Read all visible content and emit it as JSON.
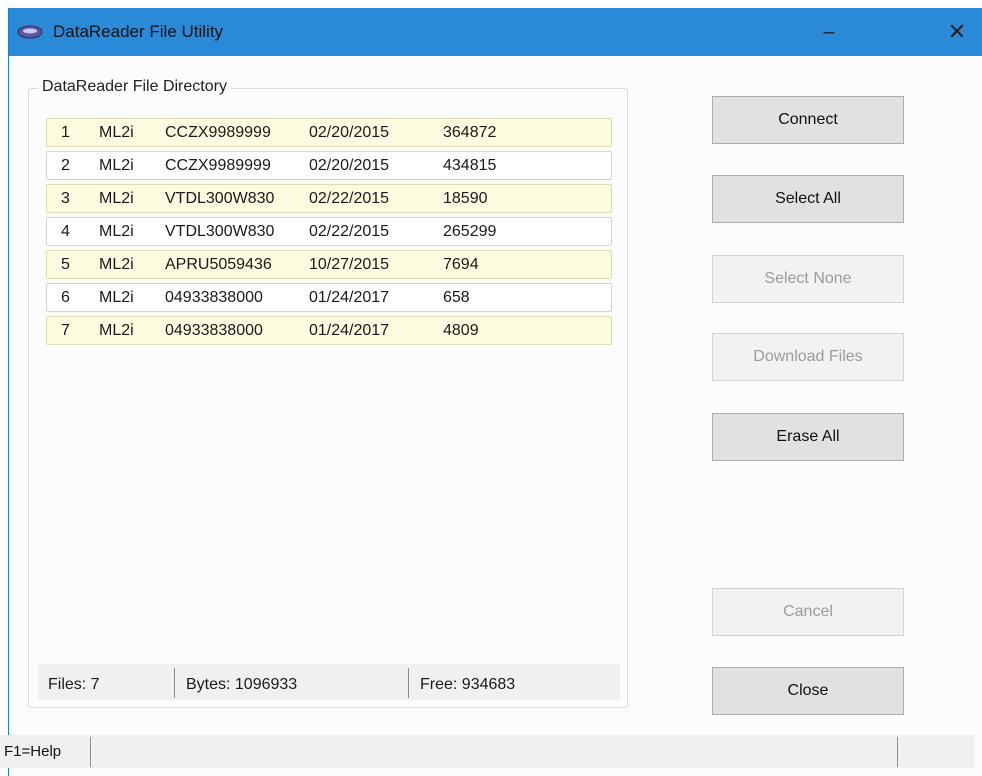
{
  "window": {
    "title": "DataReader File Utility",
    "minimize_glyph": "–",
    "close_glyph": "✕",
    "app_icon": "datareader-app-icon"
  },
  "directory": {
    "legend": "DataReader File Directory",
    "files": [
      {
        "num": "1",
        "model": "ML2i",
        "name": "CCZX9989999",
        "date": "02/20/2015",
        "size": "364872"
      },
      {
        "num": "2",
        "model": "ML2i",
        "name": "CCZX9989999",
        "date": "02/20/2015",
        "size": "434815"
      },
      {
        "num": "3",
        "model": "ML2i",
        "name": "VTDL300W830",
        "date": "02/22/2015",
        "size": "18590"
      },
      {
        "num": "4",
        "model": "ML2i",
        "name": "VTDL300W830",
        "date": "02/22/2015",
        "size": "265299"
      },
      {
        "num": "5",
        "model": "ML2i",
        "name": "APRU5059436",
        "date": "10/27/2015",
        "size": "7694"
      },
      {
        "num": "6",
        "model": "ML2i",
        "name": "04933838000",
        "date": "01/24/2017",
        "size": "658"
      },
      {
        "num": "7",
        "model": "ML2i",
        "name": "04933838000",
        "date": "01/24/2017",
        "size": "4809"
      }
    ]
  },
  "stats": {
    "files": "Files:  7",
    "bytes": "Bytes: 1096933",
    "free": "Free:  934683"
  },
  "buttons": {
    "connect": "Connect",
    "select_all": "Select All",
    "select_none": "Select None",
    "download_files": "Download Files",
    "erase_all": "Erase All",
    "cancel": "Cancel",
    "close": "Close"
  },
  "statusbar": {
    "help": "F1=Help"
  },
  "colors": {
    "titlebar": "#2b8ad7",
    "row_highlight": "#fdfbe0"
  }
}
